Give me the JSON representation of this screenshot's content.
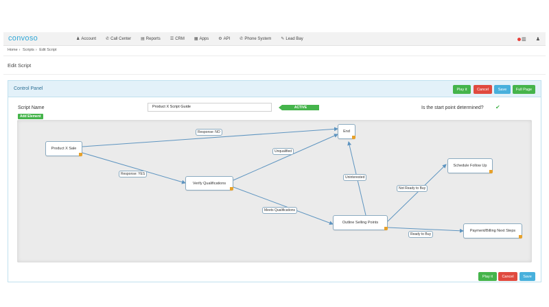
{
  "nav": {
    "logo": "convoso",
    "items": [
      {
        "id": "account",
        "icon": "user-icon",
        "glyph": "♟",
        "label": "Account"
      },
      {
        "id": "call-center",
        "icon": "phone-icon",
        "glyph": "✆",
        "label": "Call Center"
      },
      {
        "id": "reports",
        "icon": "bar-chart-icon",
        "glyph": "▤",
        "label": "Reports"
      },
      {
        "id": "crm",
        "icon": "list-icon",
        "glyph": "☰",
        "label": "CRM"
      },
      {
        "id": "apps",
        "icon": "grid-icon",
        "glyph": "▦",
        "label": "Apps"
      },
      {
        "id": "api",
        "icon": "gear-icon",
        "glyph": "⚙",
        "label": "API"
      },
      {
        "id": "phone-system",
        "icon": "phone-icon",
        "glyph": "✆",
        "label": "Phone System"
      },
      {
        "id": "lead-bay",
        "icon": "pencil-icon",
        "glyph": "✎",
        "label": "Lead Bay"
      }
    ]
  },
  "breadcrumb": [
    "Home",
    "Scripts",
    "Edit Script"
  ],
  "breadcrumb_sep": "›",
  "page_title": "Edit Script",
  "panel": {
    "title": "Control Panel",
    "buttons": {
      "play": "Play it",
      "cancel": "Cancel",
      "save": "Save",
      "full_page": "Full Page"
    }
  },
  "form": {
    "script_name_label": "Script Name",
    "script_name_value": "Product X Script Guide",
    "status": "ACTIVE",
    "add_element": "Add Element",
    "start_point_question": "Is the start point determined?"
  },
  "flow": {
    "nodes": [
      {
        "id": "product-x-sale",
        "label": "Product X Sale"
      },
      {
        "id": "end",
        "label": "End"
      },
      {
        "id": "verify-qualifications",
        "label": "Verify Qualifications"
      },
      {
        "id": "outline-selling-points",
        "label": "Outline Selling Points"
      },
      {
        "id": "schedule-follow-up",
        "label": "Schedule Follow Up"
      },
      {
        "id": "payment-billing",
        "label": "Payment/Billing Next Steps"
      }
    ],
    "edges": [
      {
        "id": "response-no",
        "label": "Response: NO",
        "from": "product-x-sale",
        "to": "end"
      },
      {
        "id": "response-yes",
        "label": "Response: YES",
        "from": "product-x-sale",
        "to": "verify-qualifications"
      },
      {
        "id": "unqualified",
        "label": "Unqualified",
        "from": "verify-qualifications",
        "to": "end"
      },
      {
        "id": "meets-qualifications",
        "label": "Meets Qualifications",
        "from": "verify-qualifications",
        "to": "outline-selling-points"
      },
      {
        "id": "uninterested",
        "label": "Uninterested",
        "from": "outline-selling-points",
        "to": "end"
      },
      {
        "id": "not-ready",
        "label": "Not Ready to Buy",
        "from": "outline-selling-points",
        "to": "schedule-follow-up"
      },
      {
        "id": "ready",
        "label": "Ready to Buy",
        "from": "outline-selling-points",
        "to": "payment-billing"
      }
    ]
  },
  "footer_buttons": {
    "play": "Play it",
    "cancel": "Cancel",
    "save": "Save"
  },
  "colors": {
    "green": "#45b44b",
    "red": "#e04a3f",
    "blue": "#48b0dc",
    "edge": "#5d94c0",
    "handle": "#e6a12c"
  }
}
